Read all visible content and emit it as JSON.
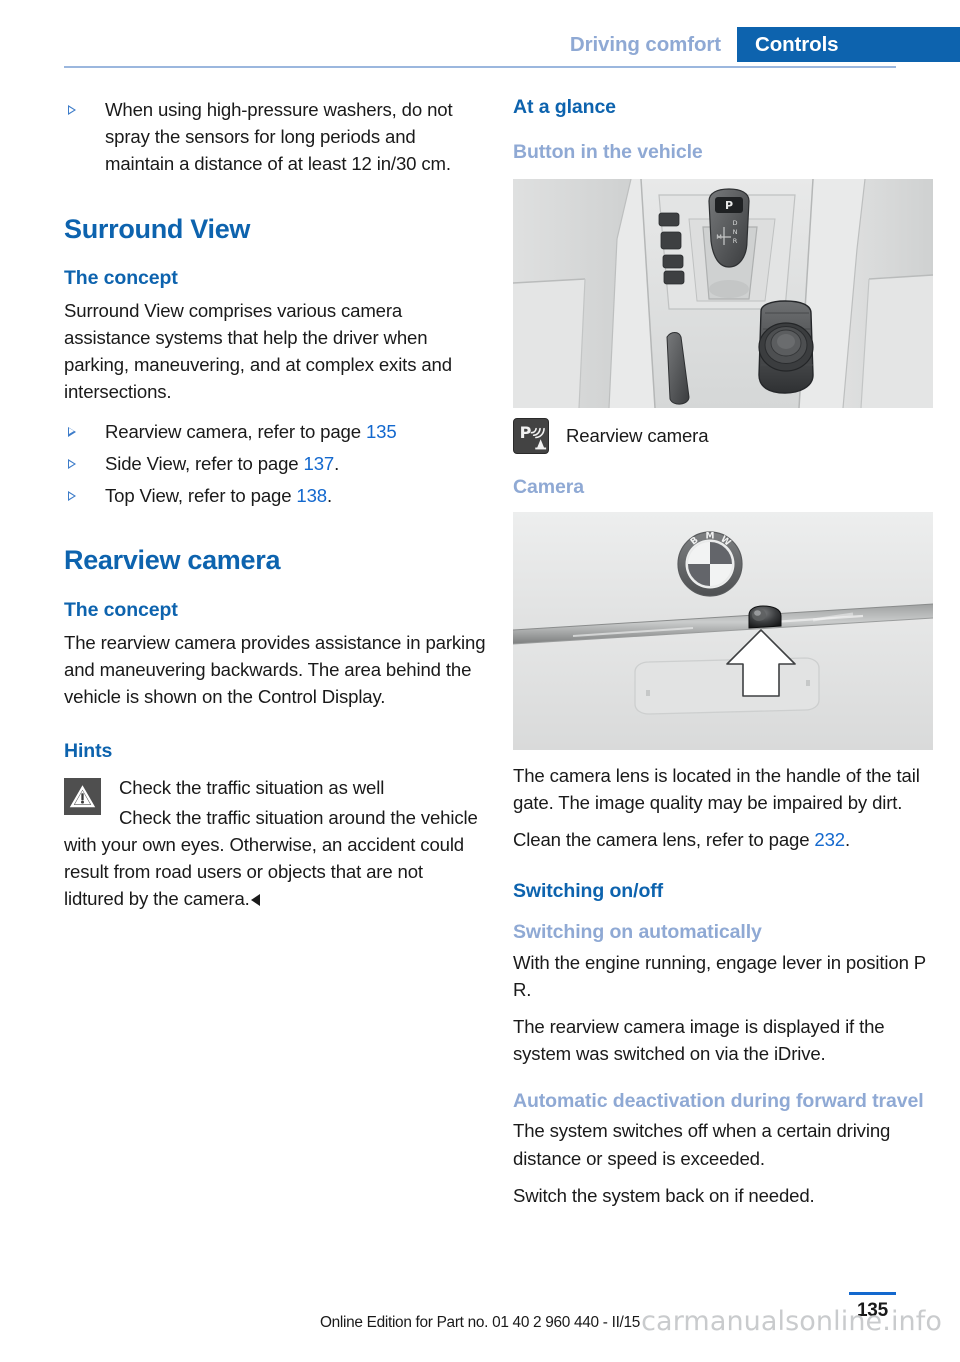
{
  "header": {
    "secondary_tab": "Driving comfort",
    "primary_tab": "Controls"
  },
  "colors": {
    "heading_blue": "#0D63AE",
    "muted_blue": "#8FA9D4",
    "link_blue": "#1368CE",
    "tab_bg": "#0D63AE",
    "rule_blue": "#9BB7DE",
    "figure_bg": "#E9EAEA",
    "warning_icon_bg": "#4F4F4F",
    "button_icon_bg": "#434343",
    "watermark": "#C9CBCD"
  },
  "left_column": {
    "top_bullet": "When using high-pressure washers, do not spray the sensors for long periods and maintain a distance of at least 12 in/30 cm.",
    "surround_view": {
      "title": "Surround View",
      "concept_heading": "The concept",
      "concept_text": "Surround View comprises various camera assistance systems that help the driver when parking, maneuvering, and at complex exits and intersections.",
      "links": [
        {
          "text": "Rearview camera, refer to page ",
          "page": "135",
          "suffix": ""
        },
        {
          "text": "Side View, refer to page ",
          "page": "137",
          "suffix": "."
        },
        {
          "text": "Top View, refer to page ",
          "page": "138",
          "suffix": "."
        }
      ]
    },
    "rearview_camera": {
      "title": "Rearview camera",
      "concept_heading": "The concept",
      "concept_text": "The rearview camera provides assistance in parking and maneuvering backwards. The area behind the vehicle is shown on the Control Display.",
      "hints_heading": "Hints",
      "warning_title": "Check the traffic situation as well",
      "warning_text": "Check the traffic situation around the vehicle with your own eyes. Otherwise, an accident could result from road users or objects that are not lidtured by the camera."
    }
  },
  "right_column": {
    "at_a_glance_heading": "At a glance",
    "button_in_vehicle_heading": "Button in the vehicle",
    "console_figure_alt": "center-console-illustration",
    "button_legend_label": "Rearview camera",
    "button_legend_icon": "park-assist-camera-icon",
    "camera_heading": "Camera",
    "camera_figure_alt": "tail-gate-camera-illustration",
    "camera_text_1": "The camera lens is located in the handle of the tail gate. The image quality may be impaired by dirt.",
    "camera_text_2_prefix": "Clean the camera lens, refer to page ",
    "camera_text_2_page": "232",
    "camera_text_2_suffix": ".",
    "switching_heading": "Switching on/off",
    "switching_auto_heading": "Switching on automatically",
    "switching_auto_text_1": "With the engine running, engage lever in position P R.",
    "switching_auto_text_2": "The rearview camera image is displayed if the system was switched on via the iDrive.",
    "auto_deactivation_heading": "Automatic deactivation during forward travel",
    "auto_deactivation_text_1": "The system switches off when a certain driving distance or speed is exceeded.",
    "auto_deactivation_text_2": "Switch the system back on if needed."
  },
  "footer": {
    "edition": "Online Edition for Part no. 01 40 2 960 440 - II/15",
    "page_number": "135",
    "watermark": "carmanualsonline.info"
  }
}
